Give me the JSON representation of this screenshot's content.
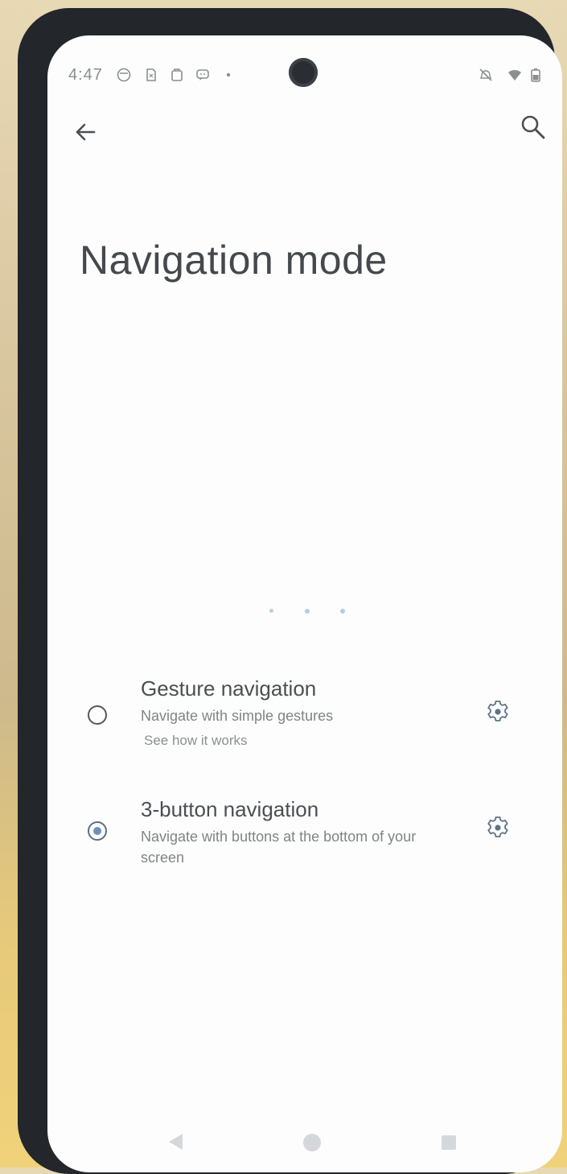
{
  "status_bar": {
    "time": "4:47",
    "icons": [
      "notification-icon-1",
      "sim-icon",
      "clipboard-icon",
      "message-icon",
      "dot-icon",
      "mute-icon",
      "wifi-icon",
      "battery-icon"
    ]
  },
  "header": {
    "back_icon": "arrow-left-icon",
    "search_icon": "search-icon"
  },
  "page": {
    "title": "Navigation mode"
  },
  "options": [
    {
      "title": "Gesture navigation",
      "subtitle": "Navigate with simple gestures",
      "link": "See how it works",
      "selected": false
    },
    {
      "title": "3-button navigation",
      "subtitle": "Navigate with buttons at the bottom of your screen",
      "selected": true
    }
  ],
  "colors": {
    "accent": "#6f8fb5",
    "background": "#fdfdfd",
    "text": "#4a4f55"
  }
}
